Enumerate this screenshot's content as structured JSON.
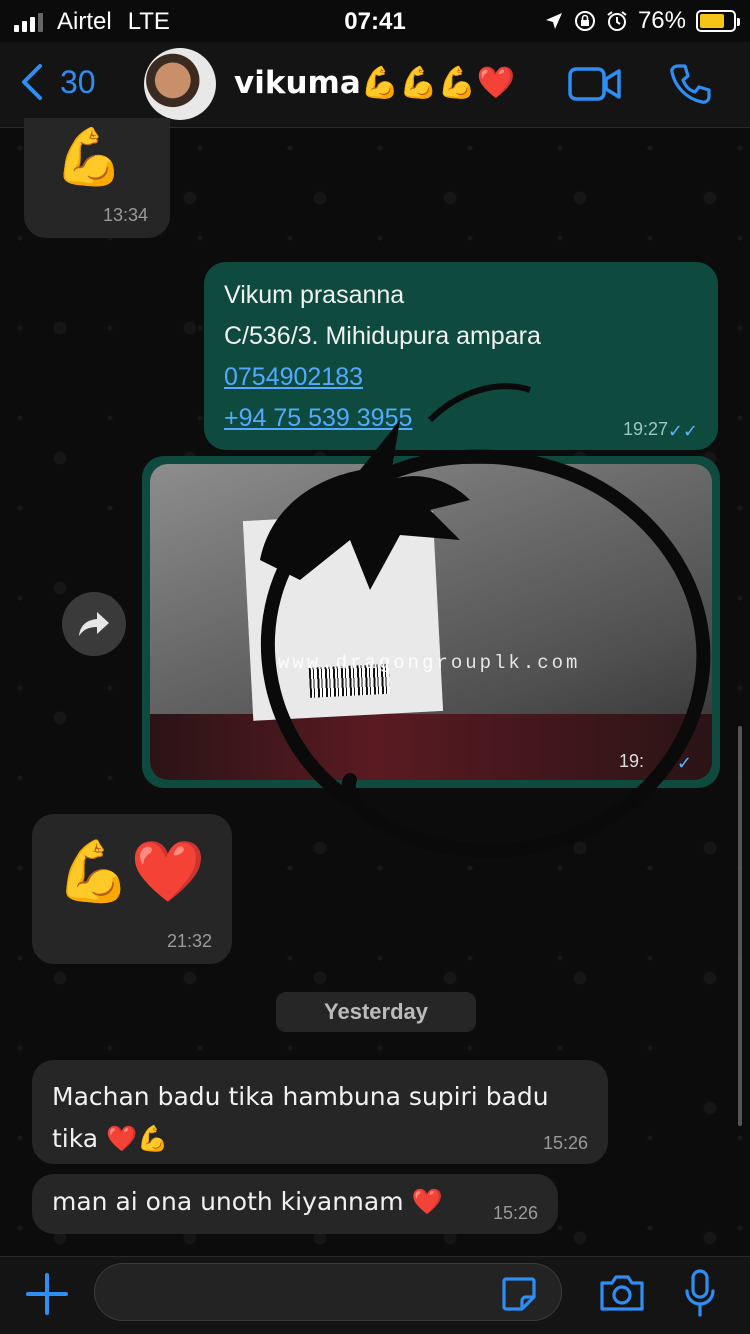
{
  "status_bar": {
    "carrier": "Airtel",
    "network": "LTE",
    "time": "07:41",
    "battery": "76%",
    "battery_level": 0.76
  },
  "header": {
    "back_count": "30",
    "contact_name": "vikuma💪💪💪❤️"
  },
  "messages": [
    {
      "direction": "incoming",
      "text": "💪",
      "time": "13:34"
    },
    {
      "direction": "outgoing",
      "lines": [
        "Vikum prasanna",
        "C/536/3. Mihidupura ampara",
        "0754902183",
        "+94 75 539 3955"
      ],
      "time": "19:27",
      "ticks": "✓✓"
    },
    {
      "direction": "outgoing",
      "type": "photo",
      "watermark": "www.dragongrouplk.com",
      "time": "19:",
      "ticks": "✓✓"
    },
    {
      "direction": "incoming",
      "text": "💪❤️",
      "time": "21:32"
    },
    {
      "direction": "incoming",
      "text": "Machan badu tika hambuna supiri badu tika ❤️💪",
      "time": "15:26"
    },
    {
      "direction": "incoming",
      "text": "man ai ona unoth kiyannam ❤️",
      "time": "15:26"
    }
  ],
  "date_separator": "Yesterday",
  "colors": {
    "accent": "#2f8ef4",
    "outgoing_bubble": "#0e4b3e",
    "incoming_bubble": "#262626",
    "link": "#53a9ff"
  }
}
